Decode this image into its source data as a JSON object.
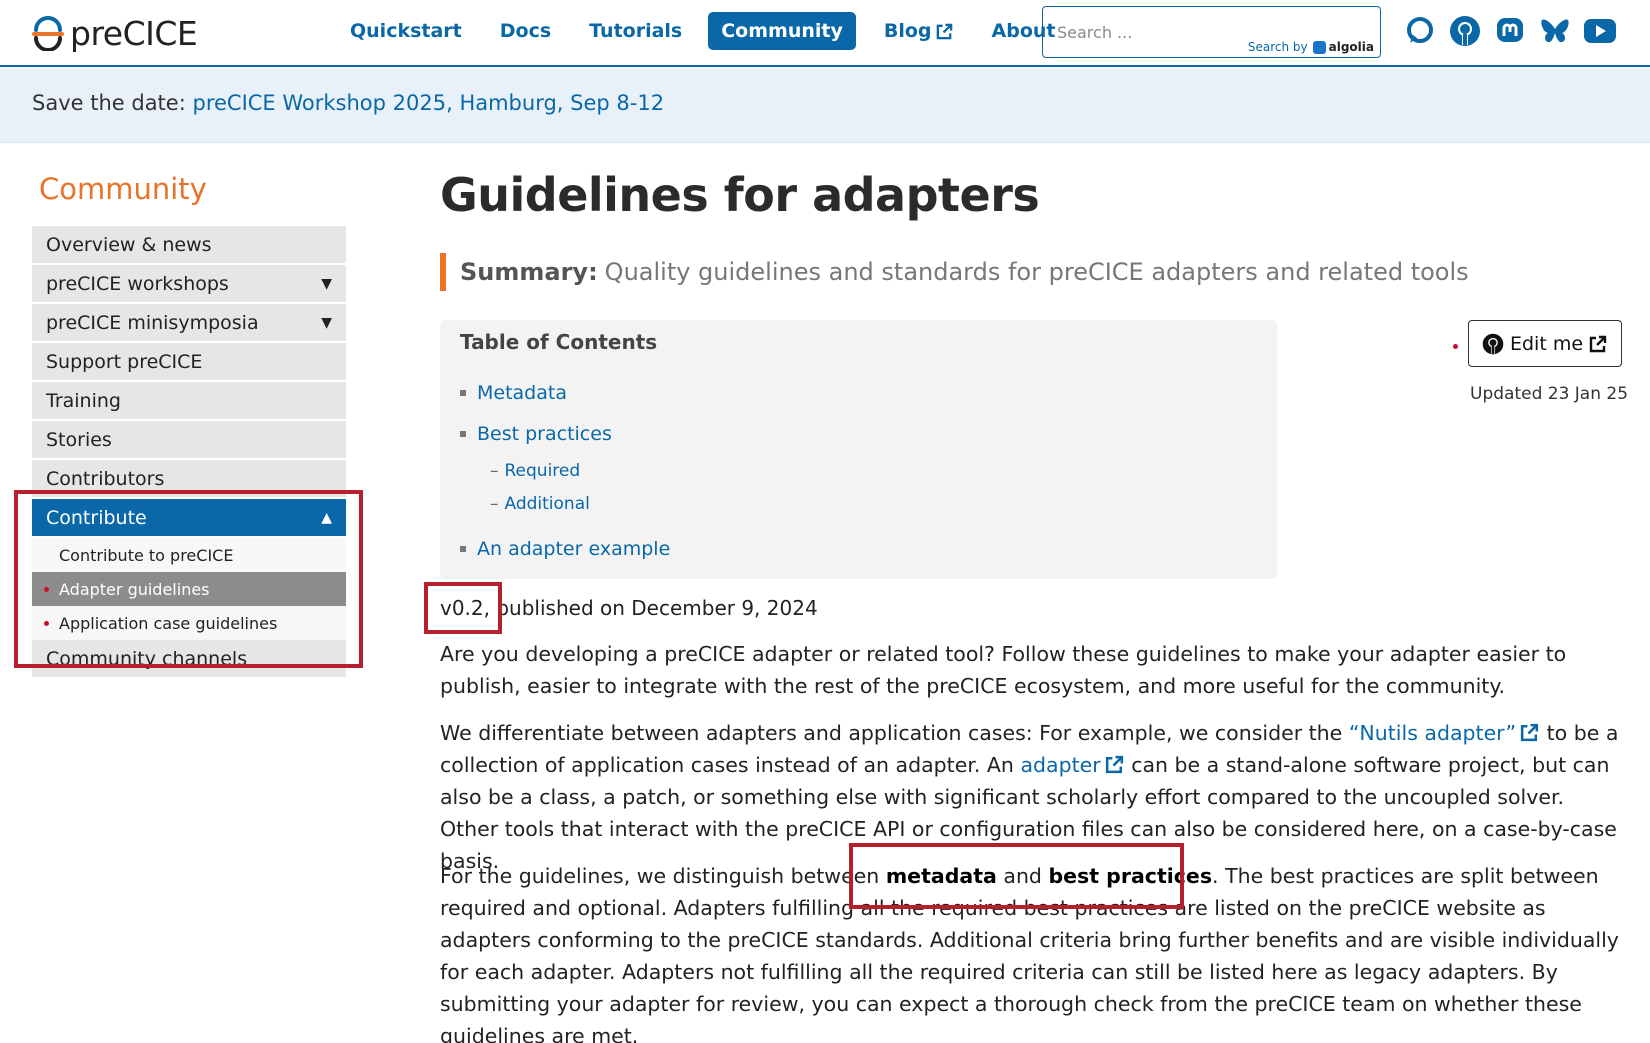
{
  "nav": {
    "logo_text": "preCICE",
    "links": [
      {
        "label": "Quickstart",
        "active": false,
        "external": false
      },
      {
        "label": "Docs",
        "active": false,
        "external": false
      },
      {
        "label": "Tutorials",
        "active": false,
        "external": false
      },
      {
        "label": "Community",
        "active": true,
        "external": false
      },
      {
        "label": "Blog",
        "active": false,
        "external": true
      },
      {
        "label": "About",
        "active": false,
        "external": false
      }
    ],
    "search_placeholder": "Search ...",
    "search_by": "Search by",
    "algolia": "algolia",
    "social_icons": [
      "discourse-icon",
      "github-icon",
      "mastodon-icon",
      "bluesky-icon",
      "youtube-icon"
    ]
  },
  "banner": {
    "prefix": "Save the date:",
    "link": "preCICE Workshop 2025, Hamburg, Sep 8-12"
  },
  "sidebar": {
    "title": "Community",
    "items": [
      {
        "label": "Overview & news",
        "caret": ""
      },
      {
        "label": "preCICE workshops",
        "caret": "▼"
      },
      {
        "label": "preCICE minisymposia",
        "caret": "▼"
      },
      {
        "label": "Support preCICE",
        "caret": ""
      },
      {
        "label": "Training",
        "caret": ""
      },
      {
        "label": "Stories",
        "caret": ""
      },
      {
        "label": "Contributors",
        "caret": ""
      },
      {
        "label": "Contribute",
        "caret": "▲"
      }
    ],
    "sub_items": [
      {
        "label": "Contribute to preCICE"
      },
      {
        "label": "Adapter guidelines"
      },
      {
        "label": "Application case guidelines"
      }
    ],
    "last_item": "Community channels"
  },
  "main": {
    "title": "Guidelines for adapters",
    "summary_label": "Summary:",
    "summary_text": "Quality guidelines and standards for preCICE adapters and related tools",
    "toc": {
      "title": "Table of Contents",
      "items": [
        "Metadata",
        "Best practices"
      ],
      "sub_items": [
        "Required",
        "Additional"
      ],
      "last_item": "An adapter example"
    },
    "edit_label": "Edit me",
    "updated": "Updated 23 Jan 25",
    "version": "v0.2, published on December 9, 2024",
    "p1": "Are you developing a preCICE adapter or related tool? Follow these guidelines to make your adapter easier to publish, easier to integrate with the rest of the preCICE ecosystem, and more useful for the community.",
    "p2_a": "We differentiate between adapters and application cases: For example, we consider the ",
    "p2_link1": "“Nutils adapter”",
    "p2_b": " to be a collection of application cases instead of an adapter. An ",
    "p2_link2": "adapter",
    "p2_c": " can be a stand-alone software project, but can also be a class, a patch, or something else with significant scholarly effort compared to the uncoupled solver. Other tools that interact with the preCICE API or configuration files can also be considered here, on a case-by-case basis.",
    "p3_a": "For the guidelines, we distinguish between ",
    "p3_bold1": "metadata",
    "p3_and": " and ",
    "p3_bold2": "best practices",
    "p3_b": ". The best practices are split between required and optional. Adapters fulfilling all the required best practices are listed on the preCICE website as adapters conforming to the preCICE standards. Additional criteria bring further benefits and are visible individually for each adapter. Adapters not fulfilling all the required criteria can still be listed here as legacy adapters. By submitting your adapter for review, you can expect a thorough check from the preCICE team on whether these guidelines are met."
  }
}
